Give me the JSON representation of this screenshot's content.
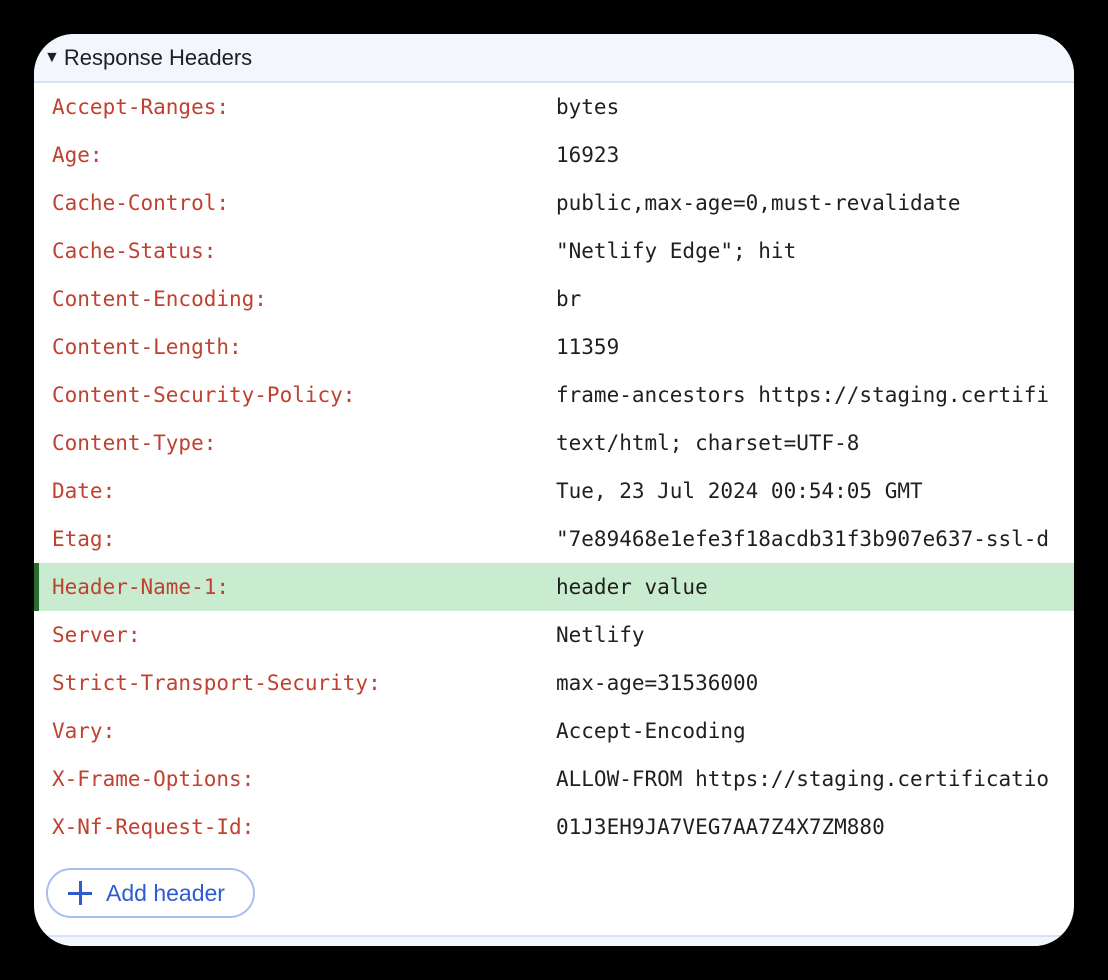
{
  "section": {
    "title": "Response Headers",
    "expanded": true
  },
  "headers": [
    {
      "name": "Accept-Ranges:",
      "value": "bytes"
    },
    {
      "name": "Age:",
      "value": "16923"
    },
    {
      "name": "Cache-Control:",
      "value": "public,max-age=0,must-revalidate"
    },
    {
      "name": "Cache-Status:",
      "value": "\"Netlify Edge\"; hit"
    },
    {
      "name": "Content-Encoding:",
      "value": "br"
    },
    {
      "name": "Content-Length:",
      "value": "11359"
    },
    {
      "name": "Content-Security-Policy:",
      "value": "frame-ancestors https://staging.certifi"
    },
    {
      "name": "Content-Type:",
      "value": "text/html; charset=UTF-8"
    },
    {
      "name": "Date:",
      "value": "Tue, 23 Jul 2024 00:54:05 GMT"
    },
    {
      "name": "Etag:",
      "value": "\"7e89468e1efe3f18acdb31f3b907e637-ssl-d"
    },
    {
      "name": "Header-Name-1:",
      "value": "header value",
      "highlighted": true
    },
    {
      "name": "Server:",
      "value": "Netlify"
    },
    {
      "name": "Strict-Transport-Security:",
      "value": "max-age=31536000"
    },
    {
      "name": "Vary:",
      "value": "Accept-Encoding"
    },
    {
      "name": "X-Frame-Options:",
      "value": "ALLOW-FROM https://staging.certificatio"
    },
    {
      "name": "X-Nf-Request-Id:",
      "value": "01J3EH9JA7VEG7AA7Z4X7ZM880"
    }
  ],
  "add_button": {
    "label": "Add header",
    "icon": "plus-icon"
  },
  "colors": {
    "header_name": "#c0412f",
    "highlight_bg": "#c9ecd1",
    "highlight_bar": "#2a6b31",
    "accent": "#2f5bd0"
  }
}
